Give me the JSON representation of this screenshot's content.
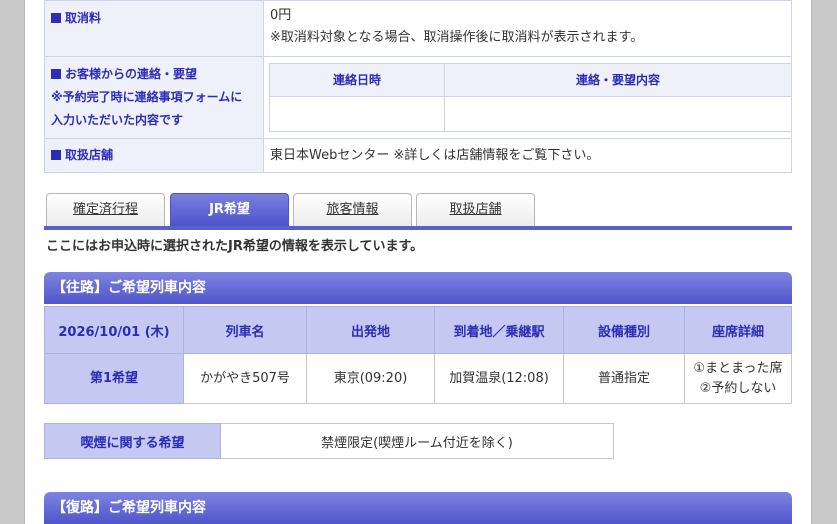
{
  "info": {
    "cancel_fee_label": "取消料",
    "cancel_fee_value": "0円",
    "cancel_fee_note": "※取消料対象となる場合、取消操作後に取消料が表示されます。",
    "contact_label_1": "お客様からの連絡・要望",
    "contact_label_2": "※予約完了時に連絡事項フォームに",
    "contact_label_3": "入力いただいた内容です",
    "contact_col_date": "連絡日時",
    "contact_col_content": "連絡・要望内容",
    "store_label": "取扱店舗",
    "store_value": "東日本Webセンター ※詳しくは店舗情報をご覧下さい。"
  },
  "tabs": [
    "確定済行程",
    "JR希望",
    "旅客情報",
    "取扱店舗"
  ],
  "note": "ここにはお申込時に選択されたJR希望の情報を表示しています。",
  "outbound": {
    "title": "【往路】ご希望列車内容",
    "headers": [
      "2026/10/01 (木)",
      "列車名",
      "出発地",
      "到着地／乗継駅",
      "設備種別",
      "座席詳細"
    ],
    "row": {
      "label": "第1希望",
      "train": "かがやき507号",
      "depart": "東京(09:20)",
      "arrive": "加賀温泉(12:08)",
      "facility": "普通指定",
      "seat_1": "①まとまった席",
      "seat_2": "②予約しない"
    }
  },
  "smoking": {
    "label": "喫煙に関する希望",
    "value": "禁煙限定(喫煙ルーム付近を除く)"
  },
  "return": {
    "title": "【復路】ご希望列車内容"
  }
}
